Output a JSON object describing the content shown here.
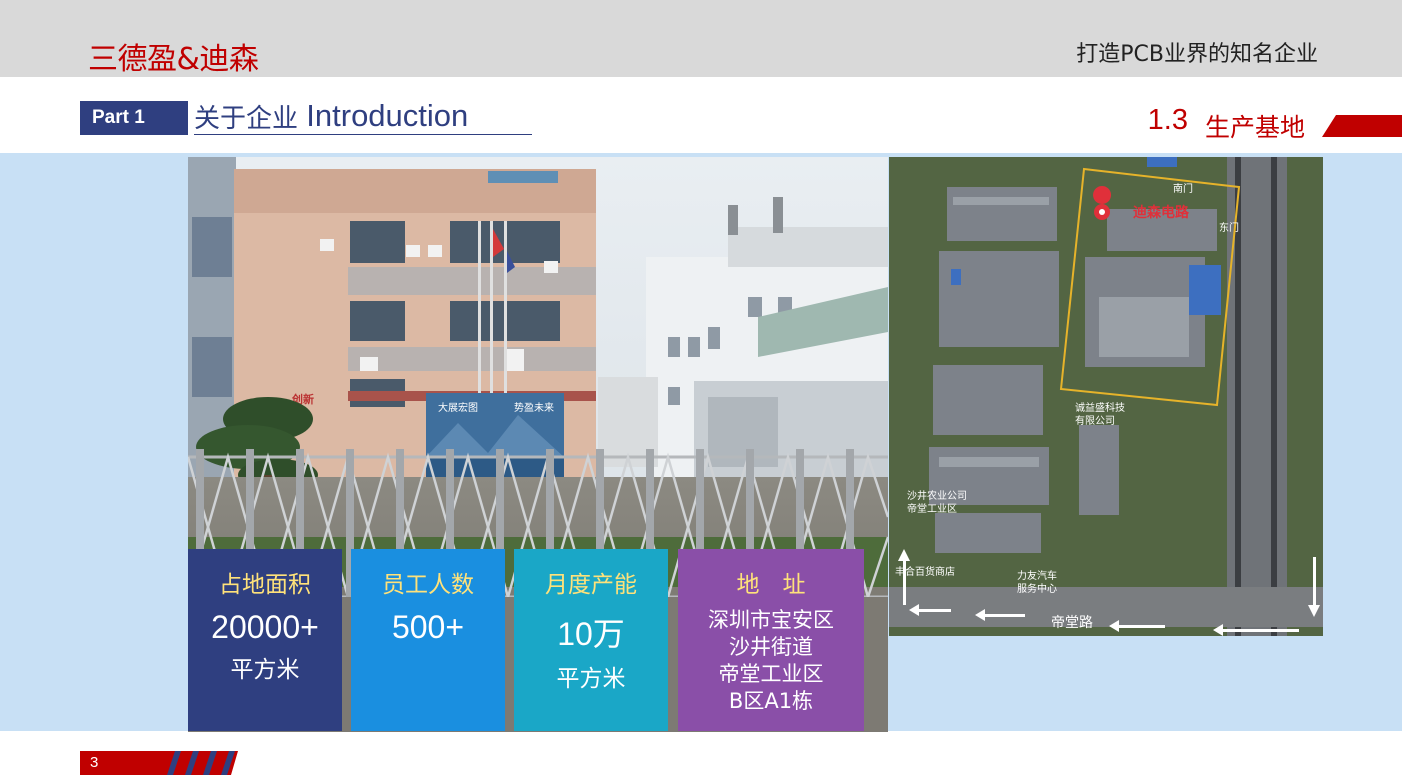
{
  "header": {
    "brand": "三德盈&迪森",
    "slogan": "打造PCB业界的知名企业"
  },
  "section": {
    "part_label": "Part 1",
    "title_cn": "关于企业",
    "title_en": "Introduction",
    "sub_number": "1.3",
    "sub_title": "生产基地"
  },
  "photo": {
    "banner_1": "创新",
    "mural_1": "大展宏图",
    "mural_2": "势盈未来"
  },
  "map": {
    "pin_label": "迪森电路",
    "north_gate": "南门",
    "east_gate": "东门",
    "poi_1a": "诚益盛科技",
    "poi_1b": "有限公司",
    "poi_2a": "沙井农业公司",
    "poi_2b": "帝堂工业区",
    "poi_3": "丰合百货商店",
    "poi_4a": "力友汽车",
    "poi_4b": "服务中心",
    "road": "帝堂路"
  },
  "stats": [
    {
      "label": "占地面积",
      "value": "20000+",
      "unit": "平方米",
      "color": "#2f3f80"
    },
    {
      "label": "员工人数",
      "value": "500+",
      "unit": "",
      "color": "#1a8fe0"
    },
    {
      "label": "月度产能",
      "value": "10万",
      "unit": "平方米",
      "color": "#1aa7c7"
    },
    {
      "label": "地　址",
      "lines": [
        "深圳市宝安区",
        "沙井街道",
        "帝堂工业区",
        "B区A1栋"
      ],
      "color": "#8a4fa8"
    }
  ],
  "footer": {
    "page_number": "3"
  },
  "colors": {
    "accent_red": "#c00000",
    "navy": "#2f3f80",
    "band_gray": "#d9d9d9",
    "band_blue": "#c8e0f5"
  }
}
